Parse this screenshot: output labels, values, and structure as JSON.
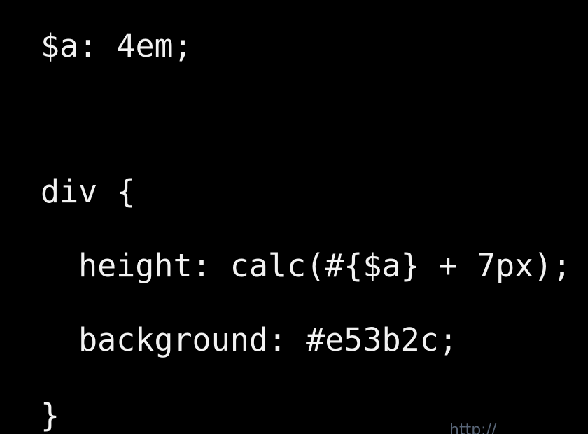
{
  "code": {
    "line_var": "$a: 4em;",
    "line_selector": "div {",
    "line_height": "height: calc(#{$a} + 7px);",
    "line_background": "background: #e53b2c;",
    "line_close": "}"
  },
  "watermark": {
    "text": "http://"
  },
  "colors": {
    "background": "#000000",
    "text": "#f2f2f2"
  }
}
